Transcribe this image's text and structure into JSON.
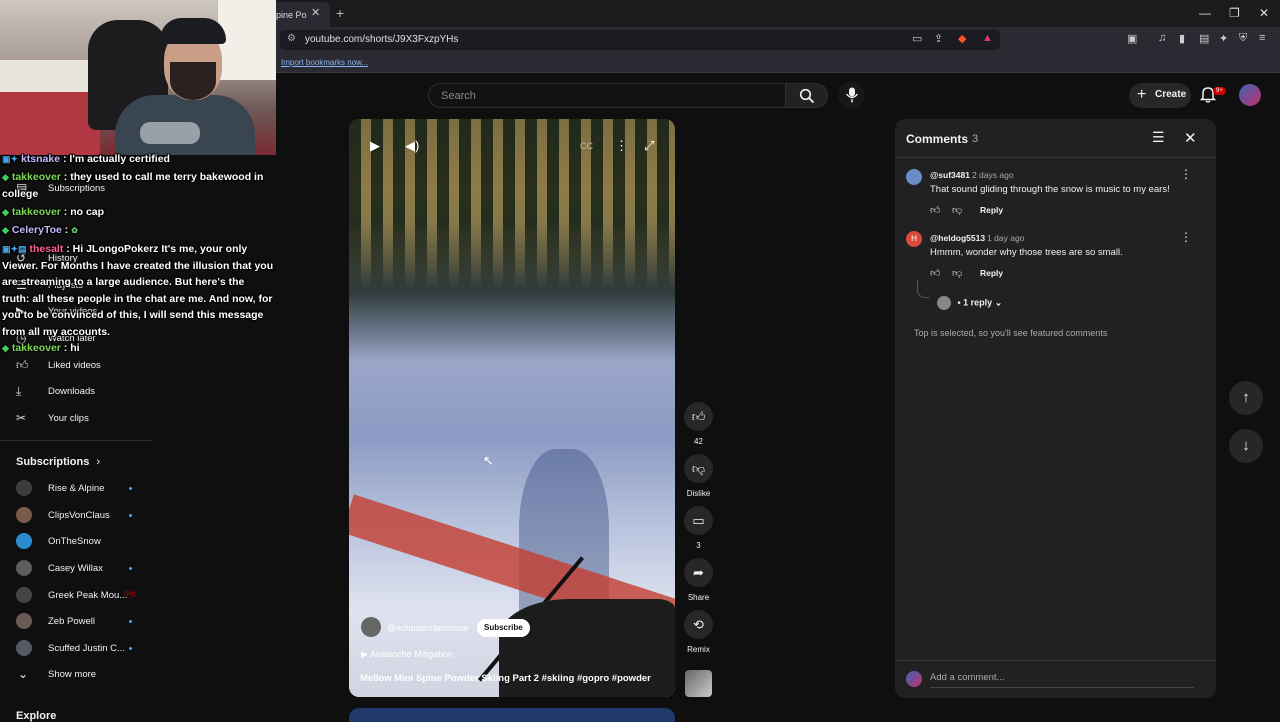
{
  "browser": {
    "tab_title": "pine Po",
    "url": "youtube.com/shorts/J9X3FxzpYHs",
    "bookmarks_link": "Import bookmarks now..."
  },
  "header": {
    "search_placeholder": "Search",
    "create_label": "Create",
    "notifications_badge": "9+"
  },
  "sidebar": {
    "items": [
      {
        "label": "Subscriptions",
        "icon": "subscriptions-icon"
      },
      {
        "label": "History",
        "icon": "history-icon"
      },
      {
        "label": "Playlists",
        "icon": "playlists-icon"
      },
      {
        "label": "Your videos",
        "icon": "your-videos-icon"
      },
      {
        "label": "Watch later",
        "icon": "watch-later-icon"
      },
      {
        "label": "Liked videos",
        "icon": "liked-videos-icon"
      },
      {
        "label": "Downloads",
        "icon": "downloads-icon"
      },
      {
        "label": "Your clips",
        "icon": "clips-icon"
      }
    ],
    "subscriptions_heading": "Subscriptions",
    "subscriptions": [
      {
        "label": "Rise & Alpine",
        "color": "#3d3d3d"
      },
      {
        "label": "ClipsVonClaus",
        "color": "#7a5a4a"
      },
      {
        "label": "OnTheSnow",
        "color": "#2a8ccf"
      },
      {
        "label": "Casey Willax",
        "color": "#5e5e5e"
      },
      {
        "label": "Greek Peak Mou...",
        "color": "#444444"
      },
      {
        "label": "Zeb Powell",
        "color": "#6a5a55"
      },
      {
        "label": "Scuffed Justin C...",
        "color": "#555a66"
      }
    ],
    "show_more": "Show more",
    "explore": "Explore"
  },
  "chat": [
    {
      "name": "ktsnake",
      "text": " : I'm actually certified",
      "color": "grey"
    },
    {
      "name": "takkeover",
      "text": " : they used to call me terry bakewood in college",
      "color": "green"
    },
    {
      "name": "takkeover",
      "text": " : no cap",
      "color": "green"
    },
    {
      "name": "CeleryToe",
      "text": " : ",
      "color": "grey"
    },
    {
      "name": "thesalt",
      "text": " : Hi JLongoPokerz It's me, your only Viewer. For Months I have created the illusion that you are streaming to a large audience. But here's the truth: all these people in the chat are me. And now, for you to be convinced of this, I will send this message from all my accounts.",
      "color": "pink"
    },
    {
      "name": "takkeover",
      "text": " : hi",
      "color": "green"
    }
  ],
  "video": {
    "channel": "@echosierraenroute",
    "subscribe": "Subscribe",
    "sound": "Avalanche Mitigation",
    "title": "Mellow Mini Spine Powder Skiing Part 2 #skiing #gopro #powder"
  },
  "actions": {
    "likes": "42",
    "dislike": "Dislike",
    "comments": "3",
    "share": "Share",
    "remix": "Remix"
  },
  "comments": {
    "title": "Comments",
    "count": "3",
    "items": [
      {
        "author": "@suf3481",
        "time": "2 days ago",
        "text": "That sound gliding through the snow is music to my ears!",
        "reply": "Reply",
        "avatar_color": "#6b8cc7"
      },
      {
        "author": "@heldog5513",
        "time": "1 day ago",
        "text": "Hmmm, wonder why those trees are so small.",
        "reply": "Reply",
        "avatar_color": "#d84a3a",
        "avatar_letter": "H"
      }
    ],
    "replies_toggle": "1 reply",
    "note": "Top is selected, so you'll see featured comments",
    "add_placeholder": "Add a comment..."
  }
}
